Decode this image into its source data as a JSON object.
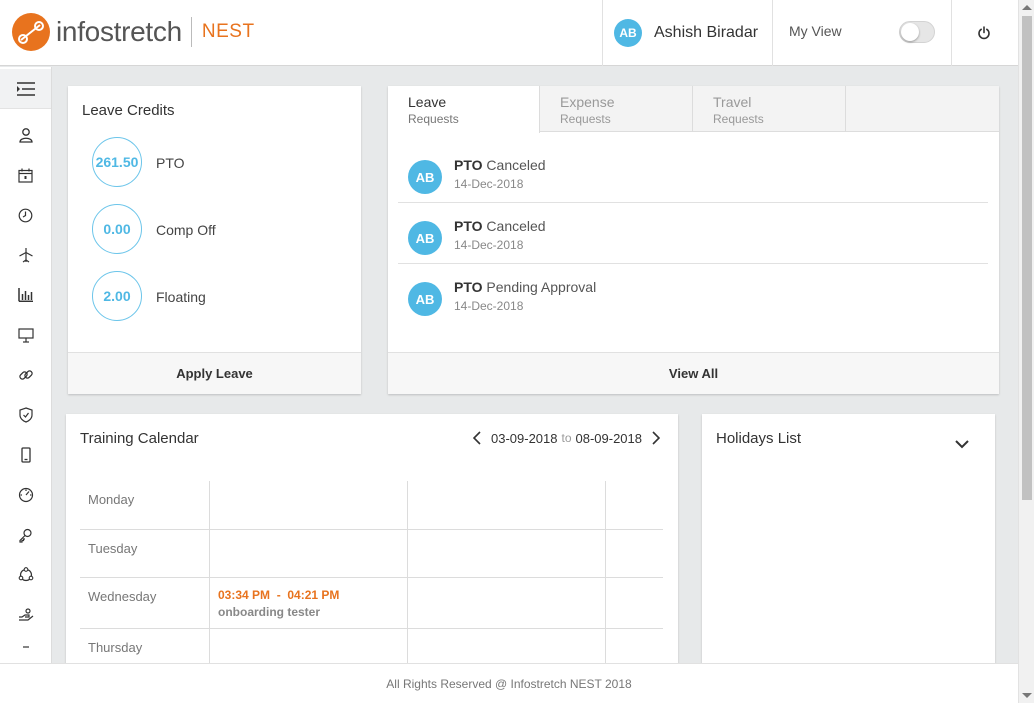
{
  "brand": {
    "name": "infostretch",
    "product": "NEST",
    "accent": "#e8731e"
  },
  "user": {
    "initials": "AB",
    "name": "Ashish Biradar"
  },
  "header": {
    "myview_label": "My View",
    "myview_on": false
  },
  "sidebar": {
    "icons": [
      "menu-icon",
      "profile-icon",
      "calendar-icon",
      "clock-icon",
      "flight-icon",
      "bar-chart-icon",
      "presentation-icon",
      "link-icon",
      "shield-icon",
      "mobile-icon",
      "dashboard-icon",
      "key-icon",
      "cycle-icon",
      "handshake-icon",
      "minus-icon"
    ]
  },
  "leave_credits": {
    "title": "Leave Credits",
    "items": [
      {
        "value": "261.50",
        "label": "PTO"
      },
      {
        "value": "0.00",
        "label": "Comp Off"
      },
      {
        "value": "2.00",
        "label": "Floating"
      }
    ],
    "action": "Apply Leave"
  },
  "requests": {
    "tabs": [
      {
        "label": "Leave",
        "sub": "Requests",
        "active": true
      },
      {
        "label": "Expense",
        "sub": "Requests",
        "active": false
      },
      {
        "label": "Travel",
        "sub": "Requests",
        "active": false
      }
    ],
    "items": [
      {
        "initials": "AB",
        "type": "PTO",
        "status": "Canceled",
        "date": "14-Dec-2018"
      },
      {
        "initials": "AB",
        "type": "PTO",
        "status": "Canceled",
        "date": "14-Dec-2018"
      },
      {
        "initials": "AB",
        "type": "PTO",
        "status": "Pending Approval",
        "date": "14-Dec-2018"
      }
    ],
    "action": "View All"
  },
  "training_calendar": {
    "title": "Training Calendar",
    "range_start": "03-09-2018",
    "range_sep": "to",
    "range_end": "08-09-2018",
    "days": [
      "Monday",
      "Tuesday",
      "Wednesday",
      "Thursday"
    ],
    "event": {
      "start": "03:34 PM",
      "sep": "-",
      "end": "04:21 PM",
      "name": "onboarding tester"
    }
  },
  "holidays": {
    "title": "Holidays List"
  },
  "footer": {
    "text": "All Rights Reserved @ Infostretch NEST 2018"
  }
}
